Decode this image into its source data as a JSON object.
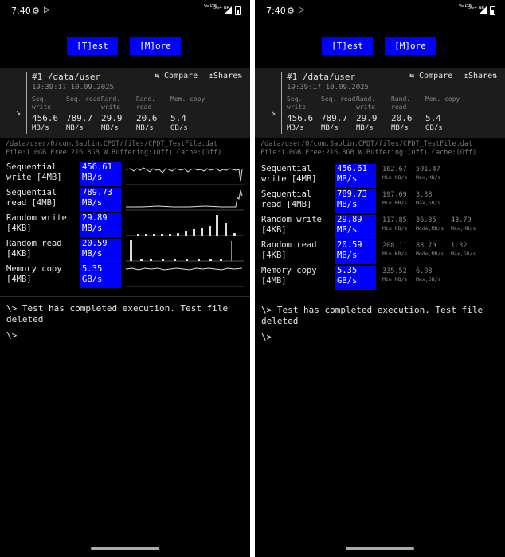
{
  "status_bar": {
    "time": "7:40",
    "volte": "Vo LTE",
    "network": "5G+ NR"
  },
  "buttons": {
    "test": "[T]est",
    "more": "[M]ore"
  },
  "summary": {
    "title": "#1 /data/user",
    "compare": "⇆ Compare",
    "share": "↥Share⇅",
    "datetime": "19:39:17 10.09.2025",
    "metrics": [
      {
        "label": "Seq. write",
        "value": "456.6",
        "unit": "MB/s"
      },
      {
        "label": "Seq. read",
        "value": "789.7",
        "unit": "MB/s"
      },
      {
        "label": "Rand. write",
        "value": "29.9",
        "unit": "MB/s"
      },
      {
        "label": "Rand. read",
        "value": "20.6",
        "unit": "MB/s"
      },
      {
        "label": "Mem. copy",
        "value": "5.4",
        "unit": "GB/s"
      }
    ]
  },
  "file_info": {
    "path": "/data/user/0/com.Saplin.CPDT/files/CPDT_TestFile.dat",
    "details": "File:1.0GB Free:216.8GB W.Buffering:(Off) Cache:(Off)"
  },
  "results": [
    {
      "name_line1": "Sequential",
      "name_line2": "write [4MB]",
      "value": "456.61",
      "unit": "MB/s",
      "stats": [
        {
          "value": "162.67",
          "label": "Min,MB/s"
        },
        {
          "value": "591.47",
          "label": "Max,MB/s"
        }
      ]
    },
    {
      "name_line1": "Sequential",
      "name_line2": "read [4MB]",
      "value": "789.73",
      "unit": "MB/s",
      "stats": [
        {
          "value": "197.69",
          "label": "Min,MB/s"
        },
        {
          "value": "3.38",
          "label": "Max,GB/s"
        }
      ]
    },
    {
      "name_line1": "Random write",
      "name_line2": "[4KB]",
      "value": "29.89",
      "unit": "MB/s",
      "stats": [
        {
          "value": "117.85",
          "label": "Min,KB/s"
        },
        {
          "value": "36.35",
          "label": "Mode,MB/s"
        },
        {
          "value": "43.79",
          "label": "Max,MB/s"
        }
      ]
    },
    {
      "name_line1": "Random read",
      "name_line2": "[4KB]",
      "value": "20.59",
      "unit": "MB/s",
      "stats": [
        {
          "value": "208.11",
          "label": "Min,KB/s"
        },
        {
          "value": "83.70",
          "label": "Mode,MB/s"
        },
        {
          "value": "1.32",
          "label": "Max,GB/s"
        }
      ]
    },
    {
      "name_line1": "Memory copy",
      "name_line2": "[4MB]",
      "value": "5.35",
      "unit": "GB/s",
      "stats": [
        {
          "value": "335.52",
          "label": "Min,MB/s"
        },
        {
          "value": "6.98",
          "label": "Max,GB/s"
        }
      ]
    }
  ],
  "console": {
    "message": "\\> Test has completed execution. Test file deleted",
    "prompt": "\\>"
  },
  "colors": {
    "accent": "#0000ff",
    "background": "#000000",
    "panel": "#1c1c1c"
  }
}
